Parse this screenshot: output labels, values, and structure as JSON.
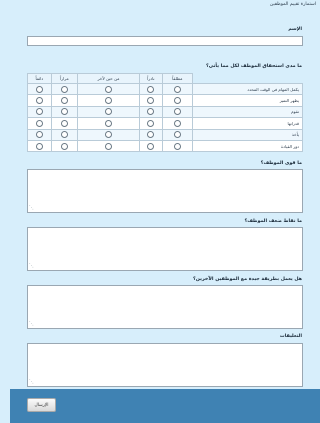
{
  "form_title": "استمارة تقييم الموظفين",
  "name_label": "الإسم",
  "rating_question": "ما مدى استحقاق الموظف لكل مما يأتي؟",
  "columns": [
    "مطلقاً",
    "نادراً",
    "من حين لآخر",
    "مراراً",
    "دائماً"
  ],
  "rows": [
    "يكمل المهام في الوقت المحدد",
    "يظهر التميز",
    "تقوم",
    "قدراتها",
    "يأخذ",
    "دور القيادة"
  ],
  "strengths_label": "ما قوى الموظف؟",
  "weaknesses_label": "ما نقاط ضعف الموظف؟",
  "teamwork_label": "هل يعمل بطريقة جيدة مع الموظفين الآخرين؟",
  "comments_label": "التعليقات",
  "submit_label": "الإرسال"
}
